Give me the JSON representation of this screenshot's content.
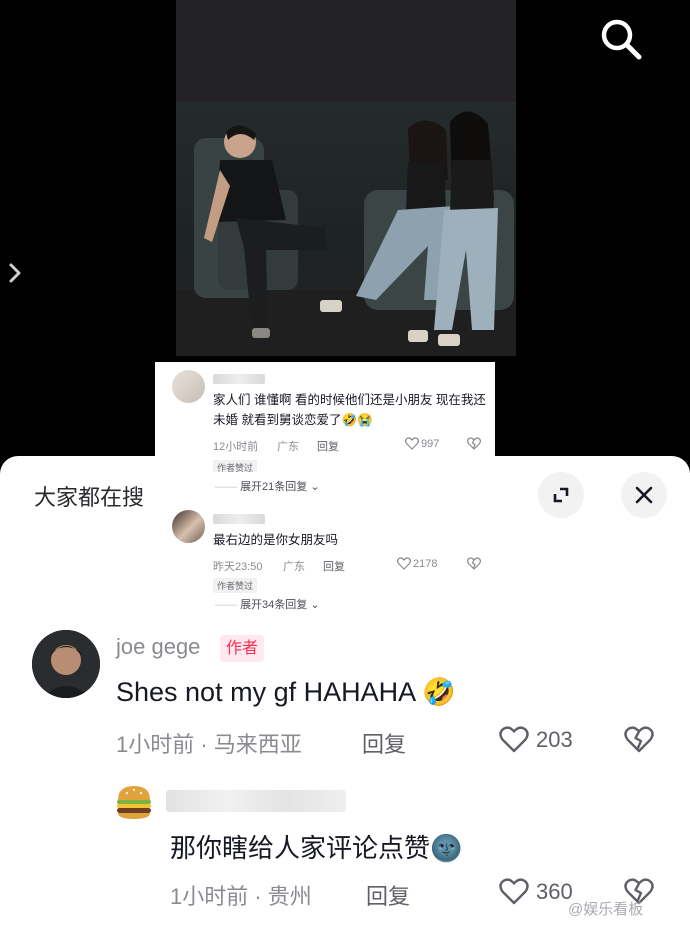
{
  "comments_preview": [
    {
      "text": "家人们 谁懂啊 看的时候他们还是小朋友 现在我还未婚 就看到舅谈恋爱了🤣😭",
      "time": "12小时前",
      "location": "广东",
      "reply": "回复",
      "likes": "997",
      "tag": "作者赞过",
      "expand": "展开21条回复"
    },
    {
      "text": "最右边的是你女朋友吗",
      "time": "昨天23:50",
      "location": "广东",
      "reply": "回复",
      "likes": "2178",
      "tag": "作者赞过",
      "expand": "展开34条回复"
    }
  ],
  "sheet": {
    "title": "大家都在搜",
    "expand_icon": "expand-icon",
    "close_icon": "close-icon"
  },
  "main_comments": [
    {
      "username": "joe gege",
      "badge": "作者",
      "text": "Shes not my gf HAHAHA 🤣",
      "time": "1小时前 · 马来西亚",
      "reply": "回复",
      "likes": "203"
    },
    {
      "text": "那你瞎给人家评论点赞🌚",
      "time": "1小时前 · 贵州",
      "reply": "回复",
      "likes": "360"
    }
  ],
  "watermark": "@娱乐看板",
  "colors": {
    "accent": "#fe2c55",
    "meta": "#8a8b91"
  }
}
